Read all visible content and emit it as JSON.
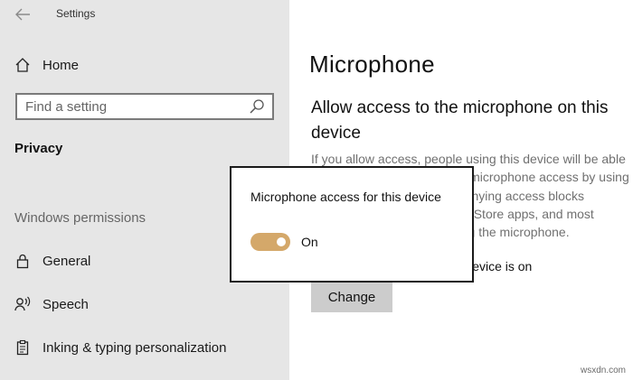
{
  "window": {
    "title": "Settings"
  },
  "sidebar": {
    "home_label": "Home",
    "search_placeholder": "Find a setting",
    "section_label": "Privacy",
    "group_label": "Windows permissions",
    "items": [
      {
        "label": "General",
        "icon": "lock-icon"
      },
      {
        "label": "Speech",
        "icon": "speech-icon"
      },
      {
        "label": "Inking & typing personalization",
        "icon": "clipboard-icon"
      }
    ]
  },
  "main": {
    "title": "Microphone",
    "sub_heading": "Allow access to the microphone on this device",
    "description": "If you allow access, people using this device will be able to choose if their apps have microphone access by using the settings on this page. Denying access blocks Windows features, Microsoft Store apps, and most desktop apps from accessing the microphone.",
    "status_text": "Microphone access for this device is on",
    "change_button": "Change"
  },
  "popup": {
    "title": "Microphone access for this device",
    "toggle_state": "On",
    "toggle_on": true,
    "toggle_color": "#d4a86a"
  },
  "watermark": "wsxdn.com"
}
